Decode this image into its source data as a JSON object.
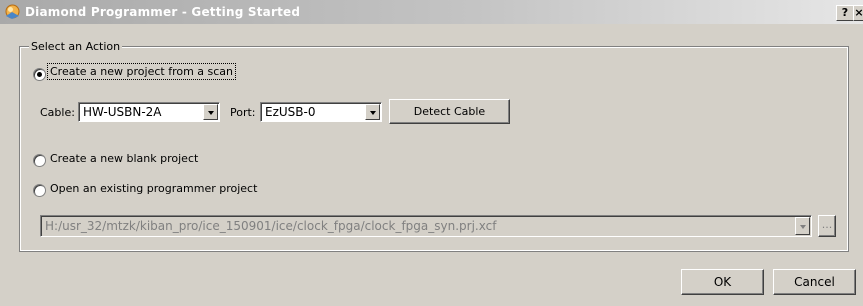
{
  "window": {
    "title": "Diamond Programmer - Getting Started",
    "help_label": "?",
    "close_label": "×"
  },
  "group": {
    "legend": "Select an Action"
  },
  "options": {
    "scan": "Create a new project from a scan",
    "blank": "Create a new blank project",
    "open": "Open an existing programmer project"
  },
  "scan": {
    "cable_label": "Cable:",
    "cable_value": "HW-USBN-2A",
    "port_label": "Port:",
    "port_value": "EzUSB-0",
    "detect_label": "Detect Cable"
  },
  "open": {
    "path_value": "H:/usr_32/mtzk/kiban_pro/ice_150901/ice/clock_fpga/clock_fpga_syn.prj.xcf",
    "browse_label": "..."
  },
  "footer": {
    "ok_label": "OK",
    "cancel_label": "Cancel"
  },
  "selected_option": "scan"
}
